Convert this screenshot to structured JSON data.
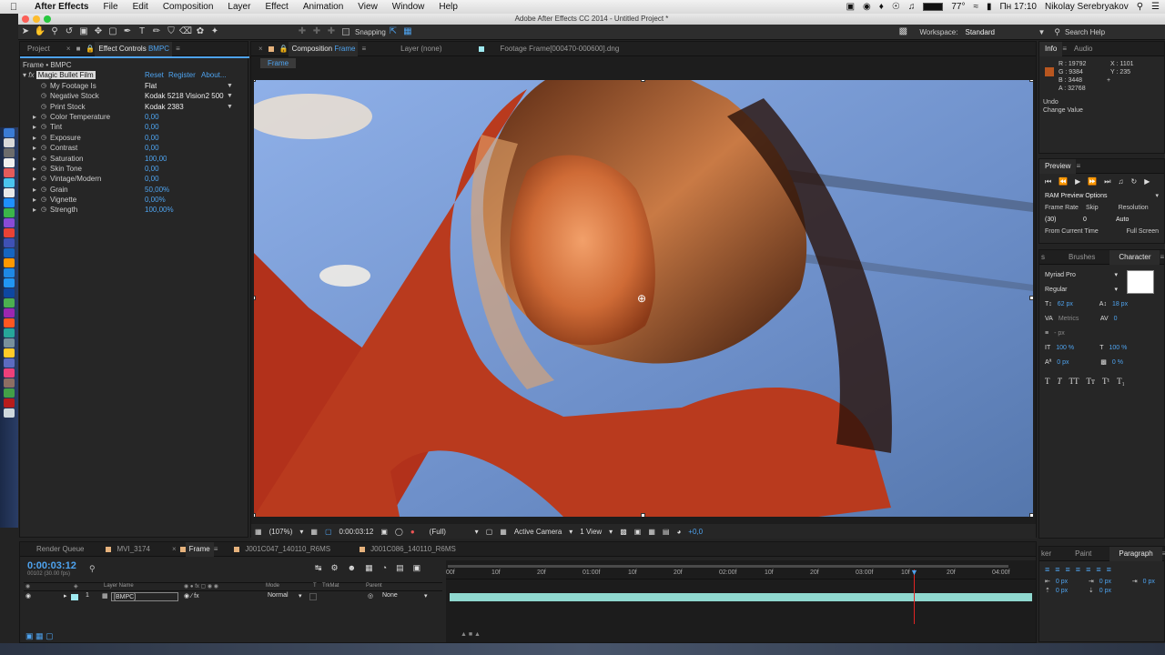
{
  "menubar": {
    "app": "After Effects",
    "items": [
      "File",
      "Edit",
      "Composition",
      "Layer",
      "Effect",
      "Animation",
      "View",
      "Window",
      "Help"
    ],
    "temp": "77°",
    "clock": "Пн 17:10",
    "user": "Nikolay Serebryakov"
  },
  "titlebar": {
    "title": "Adobe After Effects CC 2014 - Untitled Project *"
  },
  "toolbar": {
    "snapping": "Snapping",
    "workspace_label": "Workspace:",
    "workspace_value": "Standard",
    "search_placeholder": "Search Help"
  },
  "left_panel": {
    "tab_project": "Project",
    "tab_effect_controls": "Effect Controls",
    "tab_effect_target": "BMPC",
    "layer_path": "Frame • BMPC",
    "effect_name": "Magic Bullet Film",
    "reset": "Reset",
    "register": "Register",
    "about": "About...",
    "params": [
      {
        "name": "My Footage Is",
        "value": "Flat",
        "type": "dropdown"
      },
      {
        "name": "Negative Stock",
        "value": "Kodak 5218 Vision2 500",
        "type": "dropdown"
      },
      {
        "name": "Print Stock",
        "value": "Kodak 2383",
        "type": "dropdown"
      },
      {
        "name": "Color Temperature",
        "value": "0,00",
        "type": "number"
      },
      {
        "name": "Tint",
        "value": "0,00",
        "type": "number"
      },
      {
        "name": "Exposure",
        "value": "0,00",
        "type": "number"
      },
      {
        "name": "Contrast",
        "value": "0,00",
        "type": "number"
      },
      {
        "name": "Saturation",
        "value": "100,00",
        "type": "number"
      },
      {
        "name": "Skin Tone",
        "value": "0,00",
        "type": "number"
      },
      {
        "name": "Vintage/Modern",
        "value": "0,00",
        "type": "number"
      },
      {
        "name": "Grain",
        "value": "50,00%",
        "type": "number"
      },
      {
        "name": "Vignette",
        "value": "0,00%",
        "type": "number"
      },
      {
        "name": "Strength",
        "value": "100,00%",
        "type": "number"
      }
    ]
  },
  "comp_panel": {
    "tab_comp": "Composition",
    "tab_comp_name": "Frame",
    "tab_layer": "Layer (none)",
    "tab_footage": "Footage Frame[000470-000600].dng",
    "breadcrumb": "Frame",
    "footer": {
      "zoom": "(107%)",
      "time": "0:00:03:12",
      "resolution": "(Full)",
      "camera": "Active Camera",
      "views": "1 View",
      "exposure": "+0,0"
    }
  },
  "info_panel": {
    "tab_info": "Info",
    "tab_audio": "Audio",
    "r": "R : 19792",
    "g": "G : 9384",
    "b": "B : 3448",
    "a": "A : 32768",
    "x": "X : 1101",
    "y": "Y : 235",
    "swatch_color": "#b8561f",
    "undo": "Undo",
    "undo_action": "Change Value"
  },
  "preview_panel": {
    "title": "Preview",
    "ram": "RAM Preview Options",
    "frame_rate_label": "Frame Rate",
    "skip_label": "Skip",
    "resolution_label": "Resolution",
    "frame_rate": "(30)",
    "skip": "0",
    "resolution": "Auto",
    "from_current": "From Current Time",
    "full_screen": "Full Screen"
  },
  "character_panel": {
    "tab_s": "s",
    "tab_brushes": "Brushes",
    "tab_character": "Character",
    "font": "Myriad Pro",
    "style": "Regular",
    "size": "62 px",
    "leading": "18 px",
    "kerning": "Metrics",
    "tracking": "0",
    "stroke": "- px",
    "vscale": "100 %",
    "hscale": "100 %",
    "baseline": "0 px",
    "tsume": "0 %",
    "styles": [
      "T",
      "T",
      "TT",
      "Tт",
      "T¹",
      "T₁"
    ]
  },
  "paragraph_panel": {
    "tab_ker": "ker",
    "tab_paint": "Paint",
    "tab_paragraph": "Paragraph",
    "indent_left": "0 px",
    "indent_right": "0 px",
    "indent_first": "0 px",
    "space_before": "0 px",
    "space_after": "0 px"
  },
  "timeline": {
    "tabs": [
      "Render Queue",
      "MVI_3174",
      "Frame",
      "J001C047_140110_R6MS",
      "J001C086_140110_R6MS"
    ],
    "timecode": "0:00:03:12",
    "fps": "00102 (30.00 fps)",
    "col_layer_name": "Layer Name",
    "col_mode": "Mode",
    "col_t": "T",
    "col_trkmat": "TrkMat",
    "col_parent": "Parent",
    "layer_index": "1",
    "layer_name": "[BMPC]",
    "layer_mode": "Normal",
    "layer_parent": "None",
    "ruler_labels": [
      "00f",
      "10f",
      "20f",
      "01:00f",
      "10f",
      "20f",
      "02:00f",
      "10f",
      "20f",
      "03:00f",
      "10f",
      "20f",
      "04:00f"
    ],
    "playhead_frame": 102,
    "total_frames": 130
  }
}
